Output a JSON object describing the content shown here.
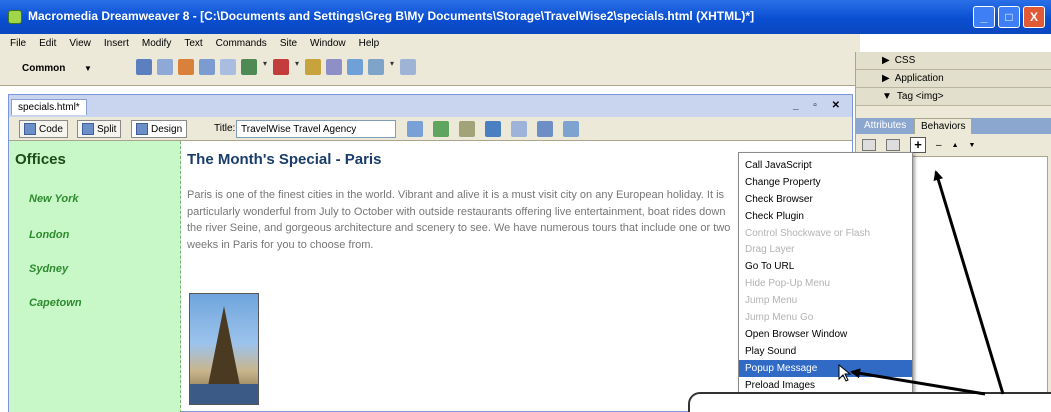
{
  "window": {
    "title": "Macromedia Dreamweaver 8 - [C:\\Documents and Settings\\Greg B\\My Documents\\Storage\\TravelWise2\\specials.html (XHTML)*]",
    "controls": [
      "_",
      "□",
      "X"
    ]
  },
  "menubar": [
    "File",
    "Edit",
    "View",
    "Insert",
    "Modify",
    "Text",
    "Commands",
    "Site",
    "Window",
    "Help"
  ],
  "insertbar": {
    "category": "Common",
    "arrow": "▼"
  },
  "panel": {
    "groups": [
      "CSS",
      "Application",
      "Tag <img>"
    ],
    "tabs": [
      "Attributes",
      "Behaviors"
    ],
    "toolbar": {
      "add": "+",
      "remove": "–",
      "up": "▲",
      "down": "▼"
    }
  },
  "document": {
    "tab": "specials.html*",
    "window_controls": "_ ▫ ✕",
    "view_buttons": [
      "Code",
      "Split",
      "Design"
    ],
    "title_label": "Title:",
    "title_value": "TravelWise Travel Agency"
  },
  "page": {
    "sidebar_heading": "Offices",
    "links": [
      "New York",
      "London",
      "Sydney",
      "Capetown"
    ],
    "heading": "The Month's Special - Paris",
    "paragraph": "Paris is one of the finest cities in the world. Vibrant and alive it is a must visit city on any European holiday. It is particularly wonderful from July to October with outside restaurants offering live entertainment, boat rides down the river Seine, and gorgeous architecture and scenery to see. We have numerous tours that include one or two weeks in Paris for you to choose from."
  },
  "behaviors_menu": {
    "items": [
      {
        "label": "Call JavaScript",
        "enabled": true
      },
      {
        "label": "Change Property",
        "enabled": true
      },
      {
        "label": "Check Browser",
        "enabled": true
      },
      {
        "label": "Check Plugin",
        "enabled": true
      },
      {
        "label": "Control Shockwave or Flash",
        "enabled": false
      },
      {
        "label": "Drag Layer",
        "enabled": false
      },
      {
        "label": "Go To URL",
        "enabled": true
      },
      {
        "label": "Hide Pop-Up Menu",
        "enabled": false
      },
      {
        "label": "Jump Menu",
        "enabled": false
      },
      {
        "label": "Jump Menu Go",
        "enabled": false
      },
      {
        "label": "Open Browser Window",
        "enabled": true
      },
      {
        "label": "Play Sound",
        "enabled": true
      },
      {
        "label": "Popup Message",
        "enabled": true,
        "selected": true
      },
      {
        "label": "Preload Images",
        "enabled": true
      }
    ]
  },
  "colors": {
    "titlebar": "#0a4fd1",
    "sidebar_bg": "#c8f7c8",
    "link": "#2e8b2e",
    "selection": "#316ac5"
  }
}
